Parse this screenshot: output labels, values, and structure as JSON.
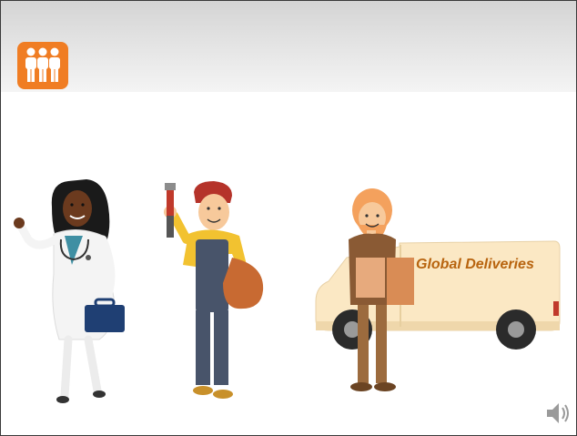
{
  "slide": {
    "truck_label": "Global Deliveries"
  },
  "icons": {
    "logo": "three-people-icon",
    "audio": "speaker-icon"
  },
  "colors": {
    "logo_bg": "#f07d23",
    "header_top": "#d4d4d4",
    "truck_body": "#fbe8c4",
    "truck_text": "#b8640f"
  }
}
